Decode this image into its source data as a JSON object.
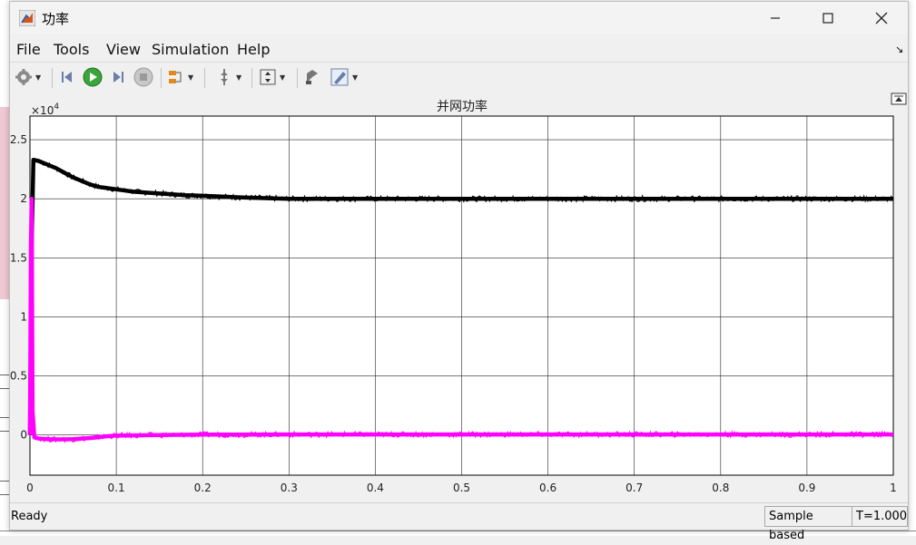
{
  "window": {
    "title": "功率"
  },
  "menu": {
    "file": "File",
    "tools": "Tools",
    "view": "View",
    "simulation": "Simulation",
    "help": "Help"
  },
  "toolbar": {
    "icons": [
      "gear-icon",
      "step-back-icon",
      "run-icon",
      "step-forward-icon",
      "stop-icon",
      "signal-selector-icon",
      "cursor-icon",
      "zoom-fit-icon",
      "style-icon",
      "edit-icon"
    ]
  },
  "status": {
    "state": "Ready",
    "sample_mode": "Sample based",
    "time": "T=1.000"
  },
  "chart_data": {
    "type": "line",
    "title": "并网功率",
    "xlabel": "",
    "ylabel": "",
    "y_exponent": "×10",
    "y_exponent_power": "4",
    "xlim": [
      0,
      1
    ],
    "ylim": [
      -0.34,
      2.7
    ],
    "x_ticks": [
      "0",
      "0.1",
      "0.2",
      "0.3",
      "0.4",
      "0.5",
      "0.6",
      "0.7",
      "0.8",
      "0.9",
      "1"
    ],
    "y_ticks": [
      "0",
      "0.5",
      "1",
      "1.5",
      "2",
      "2.5"
    ],
    "y_tick_values": [
      0,
      0.5,
      1,
      1.5,
      2,
      2.5
    ],
    "grid": true,
    "series": [
      {
        "color": "#000000",
        "x": [
          0,
          0.002,
          0.004,
          0.01,
          0.02,
          0.03,
          0.04,
          0.05,
          0.06,
          0.07,
          0.08,
          0.09,
          0.1,
          0.12,
          0.14,
          0.16,
          0.18,
          0.2,
          0.25,
          0.3,
          0.4,
          0.5,
          0.6,
          0.7,
          0.8,
          0.9,
          1.0
        ],
        "values": [
          0,
          1.6,
          2.33,
          2.32,
          2.29,
          2.26,
          2.22,
          2.18,
          2.15,
          2.12,
          2.1,
          2.09,
          2.08,
          2.06,
          2.05,
          2.04,
          2.03,
          2.025,
          2.01,
          2.0,
          2.0,
          2.0,
          2.0,
          2.0,
          2.0,
          2.0,
          2.0
        ]
      },
      {
        "color": "#ff00ff",
        "x": [
          0,
          0.001,
          0.002,
          0.003,
          0.005,
          0.01,
          0.02,
          0.03,
          0.04,
          0.05,
          0.06,
          0.07,
          0.08,
          0.09,
          0.1,
          0.15,
          0.2,
          0.3,
          0.4,
          0.5,
          0.6,
          0.7,
          0.8,
          0.9,
          1.0
        ],
        "values": [
          0,
          1.6,
          2.0,
          0.2,
          -0.02,
          -0.03,
          -0.035,
          -0.037,
          -0.037,
          -0.035,
          -0.03,
          -0.025,
          -0.018,
          -0.01,
          -0.005,
          0.0,
          0.003,
          0.005,
          0.005,
          0.005,
          0.005,
          0.005,
          0.005,
          0.005,
          0.005
        ]
      }
    ]
  }
}
